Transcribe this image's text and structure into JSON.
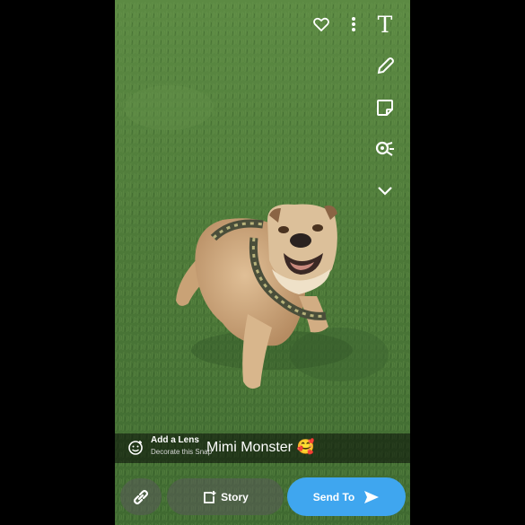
{
  "caption": {
    "text": "Mimi Monster",
    "emoji": "🥰"
  },
  "lens": {
    "title": "Add a Lens",
    "subtitle": "Decorate this Snap"
  },
  "toolbar": {
    "text_tool": "T"
  },
  "actions": {
    "story_label": "Story",
    "send_label": "Send To"
  },
  "colors": {
    "send_blue": "#3fa6ef",
    "grass": "#4f7a3a"
  },
  "icons": [
    "heart-icon",
    "more-icon",
    "text-icon",
    "pencil-icon",
    "sticker-icon",
    "scissors-icon",
    "chevron-down-icon",
    "lens-face-icon",
    "link-icon",
    "story-add-icon",
    "send-arrow-icon"
  ]
}
